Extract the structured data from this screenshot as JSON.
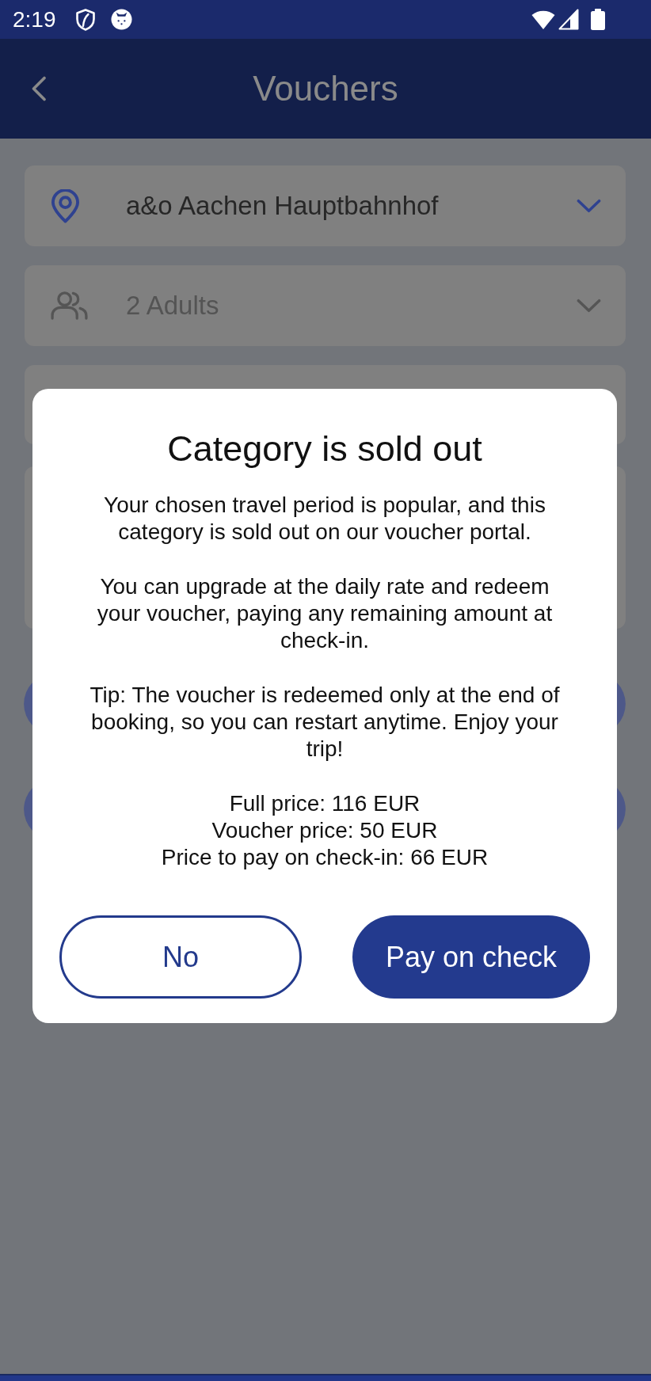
{
  "status_bar": {
    "time": "2:19"
  },
  "header": {
    "title": "Vouchers"
  },
  "form": {
    "fields": [
      {
        "kind": "location",
        "value": "a&o Aachen Hauptbahnhof",
        "disabled": false
      },
      {
        "kind": "guests",
        "value": "2 Adults",
        "disabled": true
      }
    ]
  },
  "dialog": {
    "title": "Category is sold out",
    "paragraphs": [
      "Your chosen travel period is popular, and this category is sold out on our voucher portal.",
      "You can upgrade at the daily rate and redeem your voucher, paying any remaining amount at check-in.",
      "Tip: The voucher is redeemed only at the end of booking, so you can restart anytime. Enjoy your trip!"
    ],
    "price_lines": [
      "Full price: 116 EUR",
      "Voucher price: 50 EUR",
      "Price to pay on check-in: 66 EUR"
    ],
    "buttons": [
      {
        "label": "No",
        "kind": "outline"
      },
      {
        "label": "Pay on check",
        "kind": "filled"
      }
    ]
  }
}
